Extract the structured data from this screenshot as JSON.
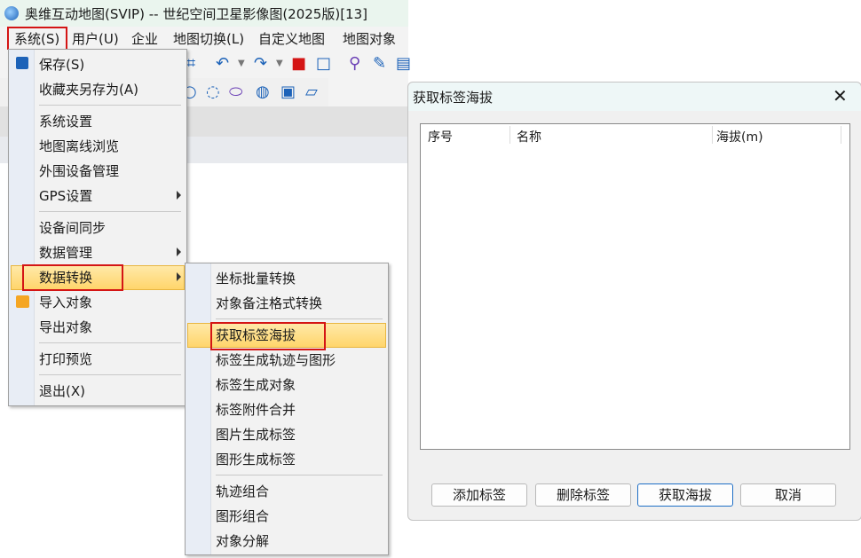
{
  "app": {
    "title": "奥维互动地图(SVIP) -- 世纪空间卫星影像图(2025版)[13]",
    "menus": [
      "系统(S)",
      "用户(U)",
      "企业",
      "地图切换(L)",
      "自定义地图",
      "地图对象"
    ]
  },
  "system_menu": {
    "items": [
      "保存(S)",
      "收藏夹另存为(A)",
      "系统设置",
      "地图离线浏览",
      "外围设备管理",
      "GPS设置",
      "设备间同步",
      "数据管理",
      "数据转换",
      "导入对象",
      "导出对象",
      "打印预览",
      "退出(X)"
    ]
  },
  "convert_submenu": {
    "items": [
      "坐标批量转换",
      "对象备注格式转换",
      "获取标签海拔",
      "标签生成轨迹与图形",
      "标签生成对象",
      "标签附件合并",
      "图片生成标签",
      "图形生成标签",
      "轨迹组合",
      "图形组合",
      "对象分解"
    ]
  },
  "dialog": {
    "title": "获取标签海拔",
    "columns": [
      "序号",
      "名称",
      "海拔(m)"
    ],
    "buttons": [
      "添加标签",
      "删除标签",
      "获取海拔",
      "取消"
    ]
  },
  "colors": {
    "highlight": "#ffd56b",
    "annotation_red": "#d41515",
    "accent_blue": "#1f6fc6"
  }
}
